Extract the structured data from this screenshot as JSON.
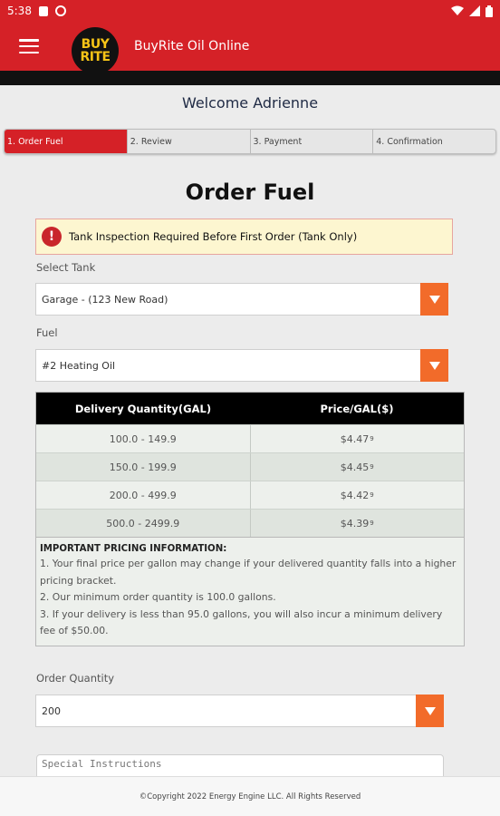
{
  "status_bar": {
    "time": "5:38"
  },
  "app_bar": {
    "logo_line1": "BUY",
    "logo_line2": "RITE",
    "title": "BuyRite Oil Online"
  },
  "welcome": "Welcome Adrienne",
  "steps": [
    {
      "label": "1. Order Fuel",
      "active": true
    },
    {
      "label": "2. Review",
      "active": false
    },
    {
      "label": "3. Payment",
      "active": false
    },
    {
      "label": "4. Confirmation",
      "active": false
    }
  ],
  "page_title": "Order Fuel",
  "alert": {
    "icon": "!",
    "text": "Tank Inspection Required Before First Order (Tank Only)"
  },
  "select_tank": {
    "label": "Select Tank",
    "value": "Garage - (123 New Road)"
  },
  "fuel": {
    "label": "Fuel",
    "value": "#2 Heating Oil"
  },
  "pricing_table": {
    "headers": [
      "Delivery Quantity(GAL)",
      "Price/GAL($)"
    ],
    "rows": [
      {
        "range": "100.0 - 149.9",
        "price": "$4.47",
        "price_sup": "9"
      },
      {
        "range": "150.0 - 199.9",
        "price": "$4.45",
        "price_sup": "9"
      },
      {
        "range": "200.0 - 499.9",
        "price": "$4.42",
        "price_sup": "9"
      },
      {
        "range": "500.0 - 2499.9",
        "price": "$4.39",
        "price_sup": "9"
      }
    ],
    "info_title": "IMPORTANT PRICING INFORMATION:",
    "info_lines": [
      "1. Your final price per gallon may change if your delivered quantity falls into a higher pricing bracket.",
      "2. Our minimum order quantity is 100.0 gallons.",
      "3. If your delivery is less than 95.0 gallons, you will also incur a minimum delivery fee of $50.00."
    ]
  },
  "order_quantity": {
    "label": "Order Quantity",
    "value": "200"
  },
  "special_instructions": {
    "placeholder": "Special Instructions"
  },
  "footer": "©Copyright 2022 Energy Engine LLC. All Rights Reserved",
  "colors": {
    "brand_red": "#d52127",
    "accent_orange": "#f26b2a",
    "logo_yellow": "#f6c417"
  }
}
